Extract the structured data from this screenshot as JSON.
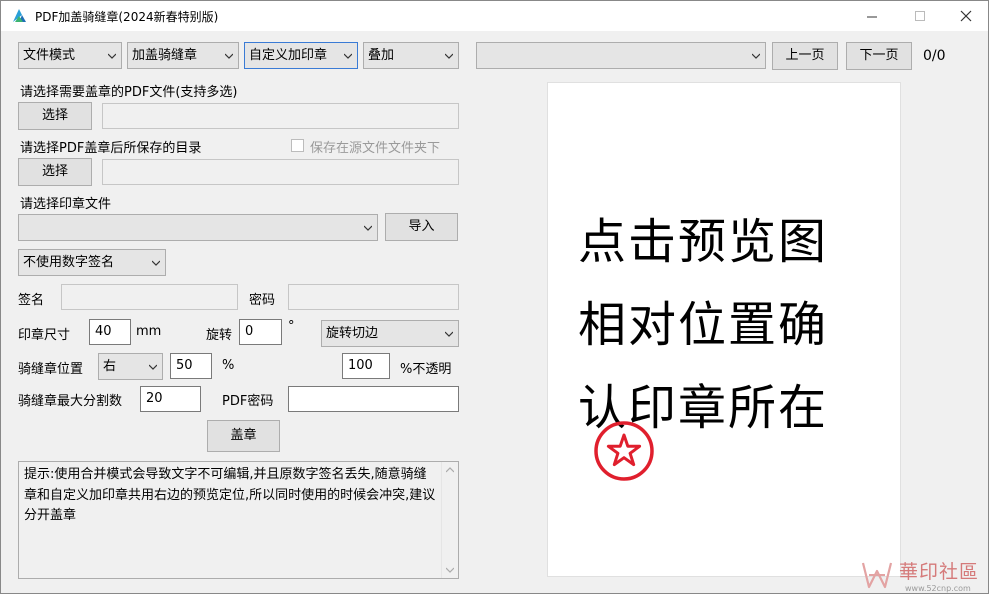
{
  "window": {
    "title": "PDF加盖骑缝章(2024新春特别版)"
  },
  "toolbar": {
    "mode": "文件模式",
    "stamp_type": "加盖骑缝章",
    "custom_stamp": "自定义加印章",
    "overlay": "叠加",
    "page_select": "",
    "prev_page": "上一页",
    "next_page": "下一页",
    "page_count": "0/0"
  },
  "pdf_files": {
    "label": "请选择需要盖章的PDF文件(支持多选)",
    "button": "选择",
    "value": ""
  },
  "save_dir": {
    "label": "请选择PDF盖章后所保存的目录",
    "checkbox_label": "保存在源文件文件夹下",
    "button": "选择",
    "value": ""
  },
  "stamp_file": {
    "label": "请选择印章文件",
    "value": "",
    "import_button": "导入"
  },
  "signature": {
    "mode": "不使用数字签名",
    "sign_label": "签名",
    "sign_value": "",
    "password_label": "密码",
    "password_value": ""
  },
  "stamp_size": {
    "label": "印章尺寸",
    "value": "40",
    "unit": "mm",
    "rotate_label": "旋转",
    "rotate_value": "0",
    "rotate_unit": "°",
    "rotate_mode": "旋转切边"
  },
  "seam_position": {
    "label": "骑缝章位置",
    "side": "右",
    "percent_value": "50",
    "percent_unit": "%",
    "opacity_value": "100",
    "opacity_label": "%不透明"
  },
  "max_split": {
    "label": "骑缝章最大分割数",
    "value": "20",
    "pdf_password_label": "PDF密码",
    "pdf_password_value": ""
  },
  "actions": {
    "stamp_button": "盖章"
  },
  "hint": {
    "text": "提示:使用合并模式会导致文字不可编辑,并且原数字签名丢失,随意骑缝章和自定义加印章共用右边的预览定位,所以同时使用的时候会冲突,建议分开盖章"
  },
  "preview": {
    "lines": [
      "点击预览图",
      "相对位置确",
      "认印章所在"
    ]
  },
  "watermark": {
    "text": "華印社區",
    "url": "www.52cnp.com"
  },
  "colors": {
    "stamp_red": "#e01f2d",
    "window_bg": "#f0f0f0",
    "focus_blue": "#3a7bd5"
  }
}
